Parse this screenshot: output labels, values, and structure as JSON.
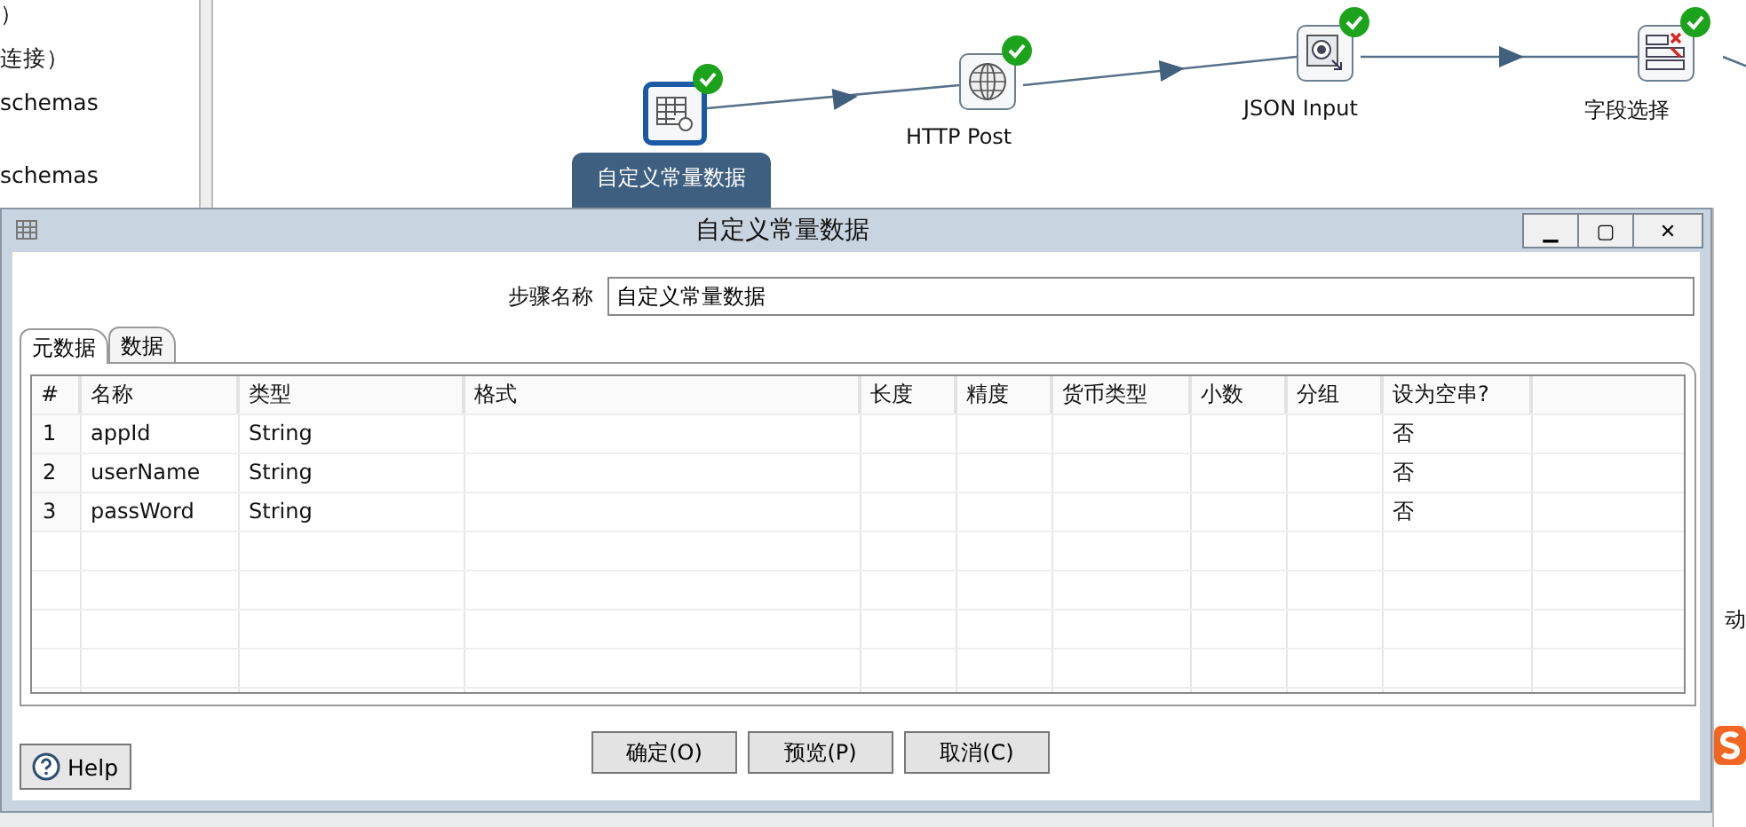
{
  "sidebar": {
    "items": [
      "）",
      "连接）",
      "schemas",
      "schemas"
    ]
  },
  "canvas": {
    "steps": [
      {
        "kind": "table",
        "label": "自定义常量数据",
        "selected": true,
        "ok": true
      },
      {
        "kind": "globe",
        "label": "HTTP Post",
        "selected": false,
        "ok": true
      },
      {
        "kind": "json",
        "label": "JSON Input",
        "selected": false,
        "ok": true
      },
      {
        "kind": "fields",
        "label": "字段选择",
        "selected": false,
        "ok": true
      }
    ]
  },
  "right_edge_text": "动",
  "dialog": {
    "title": "自定义常量数据",
    "window_buttons": [
      "▁",
      "▢",
      "✕"
    ],
    "step_name": {
      "label": "步骤名称",
      "value": "自定义常量数据"
    },
    "tabs": [
      {
        "label": "元数据",
        "selected": true
      },
      {
        "label": "数据",
        "selected": false
      }
    ],
    "table": {
      "columns": [
        "#",
        "名称",
        "类型",
        "格式",
        "长度",
        "精度",
        "货币类型",
        "小数",
        "分组",
        "设为空串?"
      ],
      "rows": [
        [
          "1",
          "appId",
          "String",
          "",
          "",
          "",
          "",
          "",
          "",
          "否"
        ],
        [
          "2",
          "userName",
          "String",
          "",
          "",
          "",
          "",
          "",
          "",
          "否"
        ],
        [
          "3",
          "passWord",
          "String",
          "",
          "",
          "",
          "",
          "",
          "",
          "否"
        ]
      ]
    },
    "buttons": [
      "确定(O)",
      "预览(P)",
      "取消(C)"
    ],
    "help": "Help"
  }
}
